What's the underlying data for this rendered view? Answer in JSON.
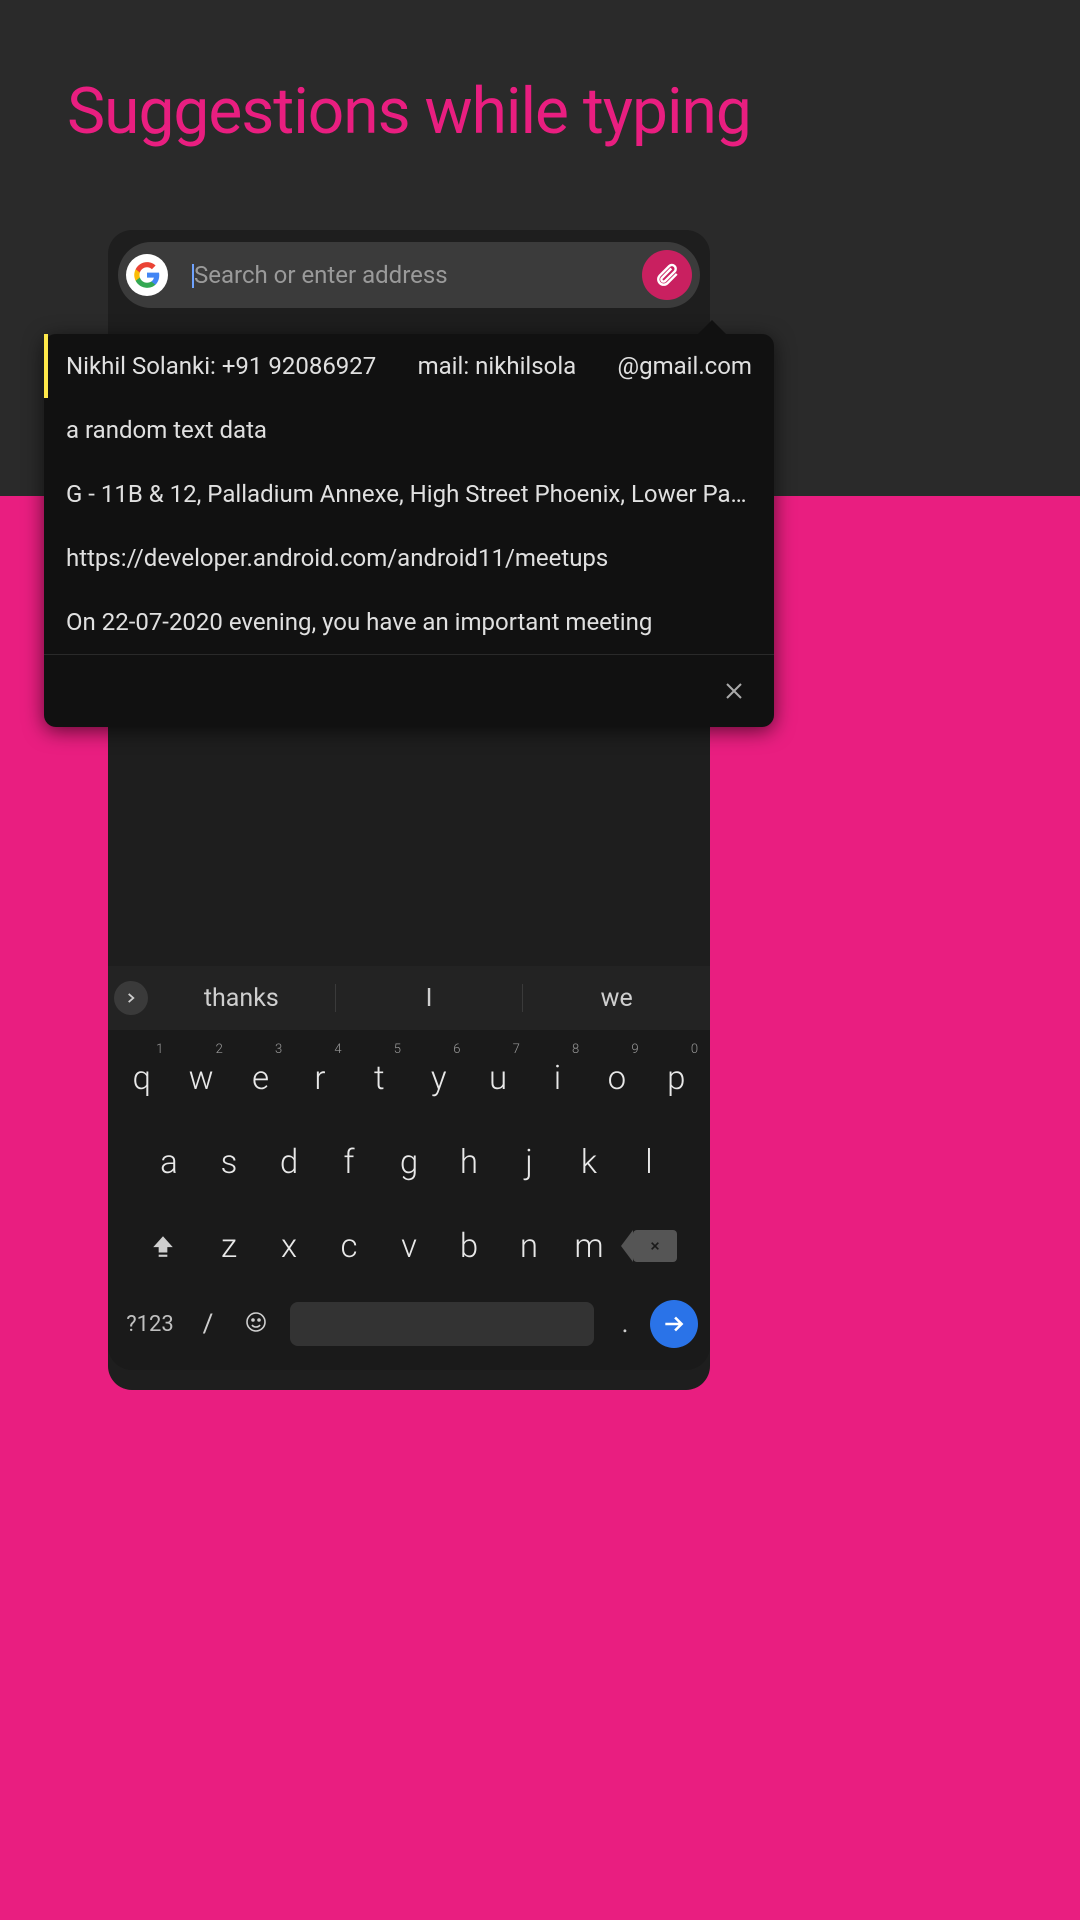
{
  "title": "Suggestions while typing",
  "search": {
    "placeholder": "Search or enter address"
  },
  "dropdown": {
    "items": [
      {
        "left": "Nikhil Solanki: +91 92086927",
        "mid": "mail: nikhilsola",
        "right": "@gmail.com"
      },
      "a random text data",
      "G - 11B & 12, Palladium Annexe, High Street Phoenix, Lower Pa…",
      "https://developer.android.com/android11/meetups",
      "On 22-07-2020 evening, you have an important meeting"
    ]
  },
  "keyboard": {
    "suggestions": [
      "thanks",
      "I",
      "we"
    ],
    "row1": [
      {
        "k": "q",
        "n": "1"
      },
      {
        "k": "w",
        "n": "2"
      },
      {
        "k": "e",
        "n": "3"
      },
      {
        "k": "r",
        "n": "4"
      },
      {
        "k": "t",
        "n": "5"
      },
      {
        "k": "y",
        "n": "6"
      },
      {
        "k": "u",
        "n": "7"
      },
      {
        "k": "i",
        "n": "8"
      },
      {
        "k": "o",
        "n": "9"
      },
      {
        "k": "p",
        "n": "0"
      }
    ],
    "row2": [
      "a",
      "s",
      "d",
      "f",
      "g",
      "h",
      "j",
      "k",
      "l"
    ],
    "row3": [
      "z",
      "x",
      "c",
      "v",
      "b",
      "n",
      "m"
    ],
    "symLabel": "?123",
    "slash": "/",
    "dot": "."
  }
}
